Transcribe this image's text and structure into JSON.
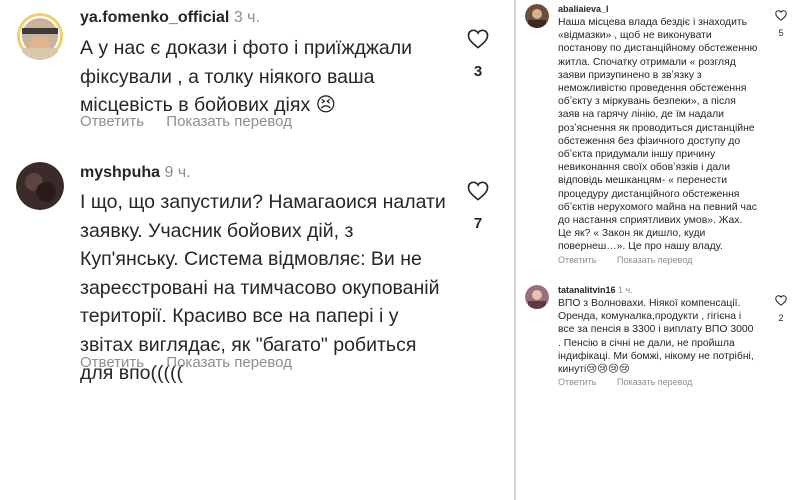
{
  "left": {
    "comments": [
      {
        "username": "ya.fomenko_official",
        "time": "3 ч.",
        "text": "А у нас є докази і фото і приїжджали фіксували , а толку ніякого ваша місцевість в бойових діях 😣",
        "likes": "3",
        "reply_label": "Ответить",
        "translate_label": "Показать перевод",
        "avatar_icon": "user-photo-avatar-icon"
      },
      {
        "username": "myshpuha",
        "time": "9 ч.",
        "text": "І що, що запустили? Намагаоися налати заявку. Учасник бойових дій, з Куп'янську. Система  відмовляє: Ви не зареєстровані на тимчасово окупованій території. Красиво все на папері і у звітах виглядає, як \"багато\" робиться для впо(((((",
        "likes": "7",
        "reply_label": "Ответить",
        "translate_label": "Показать перевод",
        "avatar_icon": "user-photo-avatar-icon"
      }
    ]
  },
  "right": {
    "comments": [
      {
        "username": "abaliaieva_l",
        "time": "",
        "text": "Наша місцева влада бездіє і знаходить «відмазки» , щоб не виконувати постанову по дистанційному обстеженню житла. Спочатку отримали « розгляд заяви призупинено в звʼязку з неможливістю проведення обстеження обʼєкту з міркувань безпеки», а після заяв на гарячу лінію, де їм надали розʼяснення як проводиться дистанційне обстеження без фізичного доступу до обʼєкта придумали іншу причину невиконання своїх обовʼязків і дали відповідь мешканцям- « перенести процедуру дистанційного обстеження обʼєктів нерухомого майна на певний час до настання сприятливих умов». Жах. Це як? « Закон як дишло, куди повернеш…». Це про нашу владу.",
        "likes": "5",
        "reply_label": "Ответить",
        "translate_label": "Показать перевод",
        "avatar_icon": "user-photo-avatar-icon"
      },
      {
        "username": "tatanalitvin16",
        "time": "1 ч.",
        "text": "ВПО з Волновахи. Ніякої компенсації. Оренда, комуналка,продукти , гігієна і все за пенсія в 3300 і виплату ВПО 3000 . Пенсію в січні не дали, не пройшла індифікаці.  Ми бомжі, нікому не потрібні, кинуті😢😢😢😢",
        "likes": "2",
        "reply_label": "Ответить",
        "translate_label": "Показать перевод",
        "avatar_icon": "user-photo-avatar-icon"
      }
    ]
  },
  "colors": {
    "text": "#262626",
    "secondary": "#8e8e8e",
    "divider": "#cfcfcf",
    "background": "#ffffff"
  }
}
